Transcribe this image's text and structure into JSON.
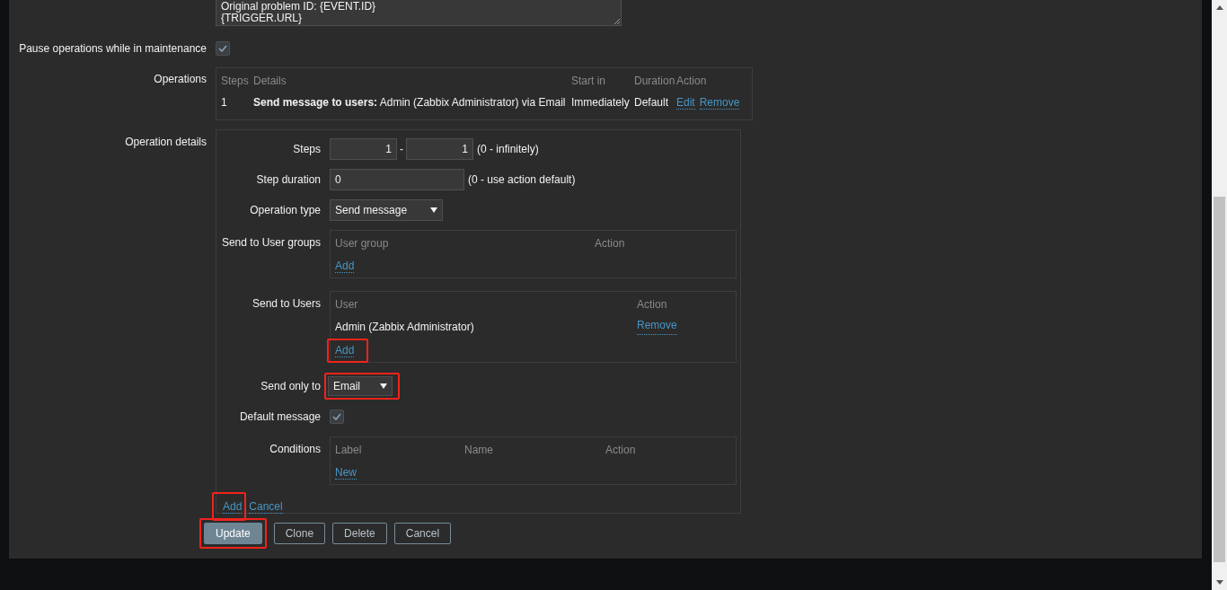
{
  "message_field": {
    "lines": [
      "Original problem ID: {EVENT.ID}",
      "{TRIGGER.URL}"
    ]
  },
  "pause_operations": {
    "label": "Pause operations while in maintenance",
    "checked": true
  },
  "operations": {
    "label": "Operations",
    "columns": [
      "Steps",
      "Details",
      "Start in",
      "Duration",
      "Action"
    ],
    "rows": [
      {
        "steps": "1",
        "details": "**Send message to users:** Admin (Zabbix Administrator) via Email",
        "start_in": "Immediately",
        "duration": "Default",
        "actions": [
          "Edit",
          "Remove"
        ]
      }
    ]
  },
  "operation_details": {
    "label": "Operation details",
    "steps": {
      "label": "Steps",
      "from": "1",
      "separator": "-",
      "to": "1",
      "hint": "(0 - infinitely)"
    },
    "step_duration": {
      "label": "Step duration",
      "value": "0",
      "hint": "(0 - use action default)"
    },
    "operation_type": {
      "label": "Operation type",
      "value": "Send message"
    },
    "user_groups": {
      "label": "Send to User groups",
      "columns": [
        "User group",
        "Action"
      ],
      "add": {
        "text": "Add"
      }
    },
    "users": {
      "label": "Send to Users",
      "columns": [
        "User",
        "Action"
      ],
      "rows": [
        {
          "name": "Admin (Zabbix Administrator)",
          "action": "Remove"
        }
      ],
      "add": {
        "text": "Add",
        "highlighted": true
      }
    },
    "send_only_to": {
      "label": "Send only to",
      "value": "Email",
      "highlighted": true
    },
    "default_message": {
      "label": "Default message",
      "checked": true
    },
    "conditions": {
      "label": "Conditions",
      "columns": [
        "Label",
        "Name",
        "Action"
      ],
      "new": "New"
    },
    "links": [
      {
        "text": "Add",
        "highlighted": true
      },
      {
        "text": "Cancel",
        "highlighted": false
      }
    ]
  },
  "buttons": [
    {
      "label": "Update",
      "kind": "primary",
      "highlighted": true
    },
    {
      "label": "Clone",
      "kind": "secondary",
      "highlighted": false
    },
    {
      "label": "Delete",
      "kind": "secondary",
      "highlighted": false
    },
    {
      "label": "Cancel",
      "kind": "secondary",
      "highlighted": false
    }
  ]
}
